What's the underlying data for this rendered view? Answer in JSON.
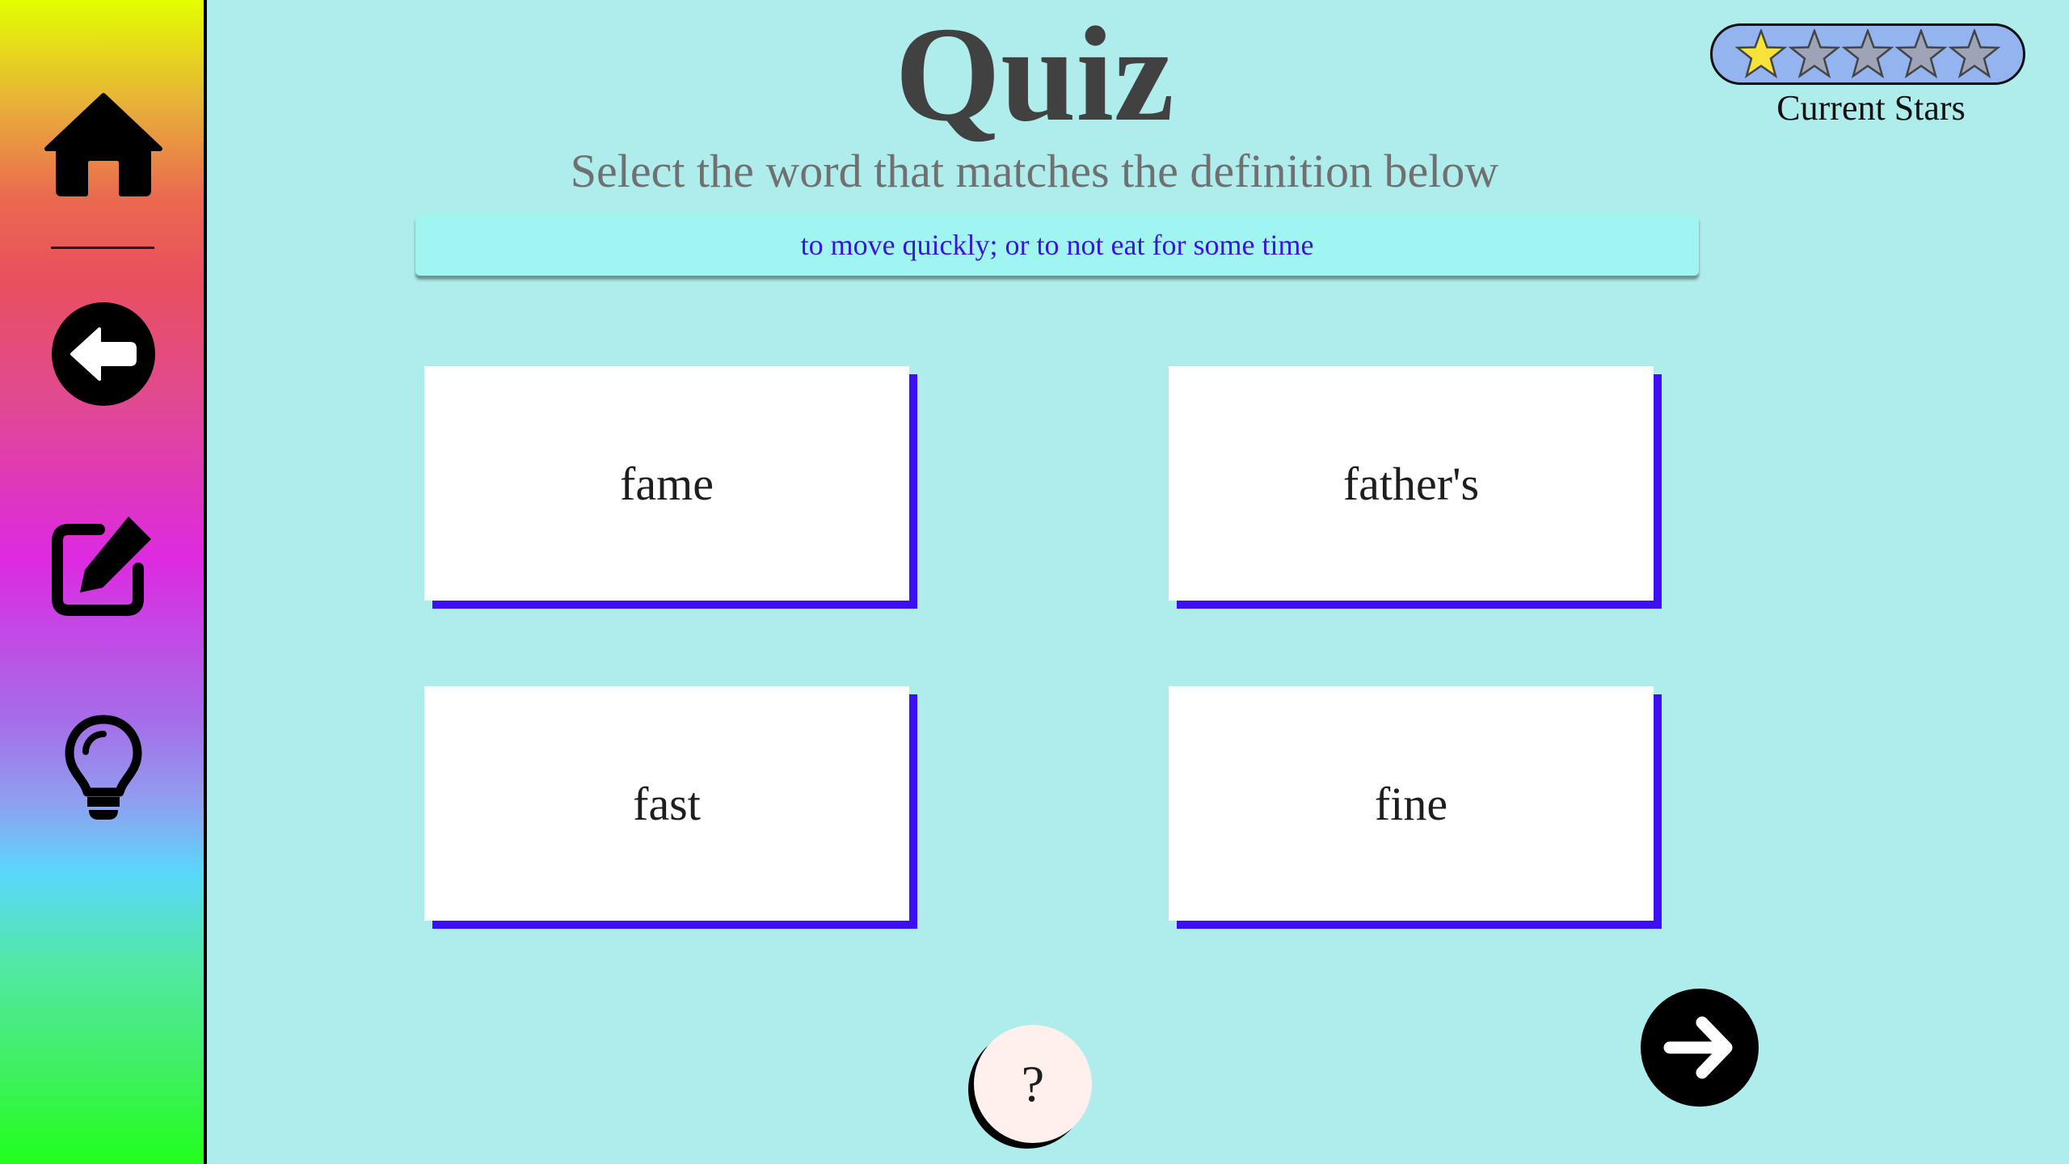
{
  "app": {
    "title": "Quiz",
    "instruction": "Select the word that matches the definition below",
    "definition": "to move quickly; or to not eat for some time"
  },
  "sidebar": {
    "items": [
      {
        "name": "home",
        "icon": "home-icon"
      },
      {
        "name": "back",
        "icon": "back-arrow-icon"
      },
      {
        "name": "edit",
        "icon": "edit-icon"
      },
      {
        "name": "hint",
        "icon": "lightbulb-icon"
      }
    ]
  },
  "answers": [
    {
      "label": "fame"
    },
    {
      "label": "father's"
    },
    {
      "label": "fast"
    },
    {
      "label": "fine"
    }
  ],
  "stars": {
    "label": "Current Stars",
    "total": 5,
    "earned": 1,
    "filled_color": "#f7e23a",
    "empty_color": "#9ea3b8"
  },
  "help": {
    "label": "?"
  },
  "colors": {
    "background": "#afecec",
    "accent": "#3d10f2",
    "definition_bg": "#a1f5f0",
    "definition_text": "#3a14e0"
  }
}
